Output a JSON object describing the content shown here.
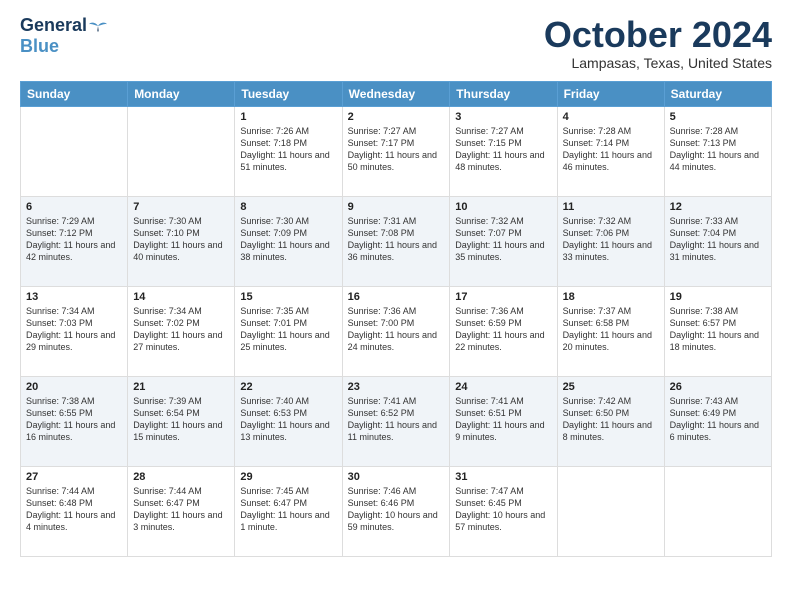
{
  "header": {
    "logo_general": "General",
    "logo_blue": "Blue",
    "month_title": "October 2024",
    "location": "Lampasas, Texas, United States"
  },
  "days_of_week": [
    "Sunday",
    "Monday",
    "Tuesday",
    "Wednesday",
    "Thursday",
    "Friday",
    "Saturday"
  ],
  "weeks": [
    [
      {
        "day": "",
        "sunrise": "",
        "sunset": "",
        "daylight": ""
      },
      {
        "day": "",
        "sunrise": "",
        "sunset": "",
        "daylight": ""
      },
      {
        "day": "1",
        "sunrise": "Sunrise: 7:26 AM",
        "sunset": "Sunset: 7:18 PM",
        "daylight": "Daylight: 11 hours and 51 minutes."
      },
      {
        "day": "2",
        "sunrise": "Sunrise: 7:27 AM",
        "sunset": "Sunset: 7:17 PM",
        "daylight": "Daylight: 11 hours and 50 minutes."
      },
      {
        "day": "3",
        "sunrise": "Sunrise: 7:27 AM",
        "sunset": "Sunset: 7:15 PM",
        "daylight": "Daylight: 11 hours and 48 minutes."
      },
      {
        "day": "4",
        "sunrise": "Sunrise: 7:28 AM",
        "sunset": "Sunset: 7:14 PM",
        "daylight": "Daylight: 11 hours and 46 minutes."
      },
      {
        "day": "5",
        "sunrise": "Sunrise: 7:28 AM",
        "sunset": "Sunset: 7:13 PM",
        "daylight": "Daylight: 11 hours and 44 minutes."
      }
    ],
    [
      {
        "day": "6",
        "sunrise": "Sunrise: 7:29 AM",
        "sunset": "Sunset: 7:12 PM",
        "daylight": "Daylight: 11 hours and 42 minutes."
      },
      {
        "day": "7",
        "sunrise": "Sunrise: 7:30 AM",
        "sunset": "Sunset: 7:10 PM",
        "daylight": "Daylight: 11 hours and 40 minutes."
      },
      {
        "day": "8",
        "sunrise": "Sunrise: 7:30 AM",
        "sunset": "Sunset: 7:09 PM",
        "daylight": "Daylight: 11 hours and 38 minutes."
      },
      {
        "day": "9",
        "sunrise": "Sunrise: 7:31 AM",
        "sunset": "Sunset: 7:08 PM",
        "daylight": "Daylight: 11 hours and 36 minutes."
      },
      {
        "day": "10",
        "sunrise": "Sunrise: 7:32 AM",
        "sunset": "Sunset: 7:07 PM",
        "daylight": "Daylight: 11 hours and 35 minutes."
      },
      {
        "day": "11",
        "sunrise": "Sunrise: 7:32 AM",
        "sunset": "Sunset: 7:06 PM",
        "daylight": "Daylight: 11 hours and 33 minutes."
      },
      {
        "day": "12",
        "sunrise": "Sunrise: 7:33 AM",
        "sunset": "Sunset: 7:04 PM",
        "daylight": "Daylight: 11 hours and 31 minutes."
      }
    ],
    [
      {
        "day": "13",
        "sunrise": "Sunrise: 7:34 AM",
        "sunset": "Sunset: 7:03 PM",
        "daylight": "Daylight: 11 hours and 29 minutes."
      },
      {
        "day": "14",
        "sunrise": "Sunrise: 7:34 AM",
        "sunset": "Sunset: 7:02 PM",
        "daylight": "Daylight: 11 hours and 27 minutes."
      },
      {
        "day": "15",
        "sunrise": "Sunrise: 7:35 AM",
        "sunset": "Sunset: 7:01 PM",
        "daylight": "Daylight: 11 hours and 25 minutes."
      },
      {
        "day": "16",
        "sunrise": "Sunrise: 7:36 AM",
        "sunset": "Sunset: 7:00 PM",
        "daylight": "Daylight: 11 hours and 24 minutes."
      },
      {
        "day": "17",
        "sunrise": "Sunrise: 7:36 AM",
        "sunset": "Sunset: 6:59 PM",
        "daylight": "Daylight: 11 hours and 22 minutes."
      },
      {
        "day": "18",
        "sunrise": "Sunrise: 7:37 AM",
        "sunset": "Sunset: 6:58 PM",
        "daylight": "Daylight: 11 hours and 20 minutes."
      },
      {
        "day": "19",
        "sunrise": "Sunrise: 7:38 AM",
        "sunset": "Sunset: 6:57 PM",
        "daylight": "Daylight: 11 hours and 18 minutes."
      }
    ],
    [
      {
        "day": "20",
        "sunrise": "Sunrise: 7:38 AM",
        "sunset": "Sunset: 6:55 PM",
        "daylight": "Daylight: 11 hours and 16 minutes."
      },
      {
        "day": "21",
        "sunrise": "Sunrise: 7:39 AM",
        "sunset": "Sunset: 6:54 PM",
        "daylight": "Daylight: 11 hours and 15 minutes."
      },
      {
        "day": "22",
        "sunrise": "Sunrise: 7:40 AM",
        "sunset": "Sunset: 6:53 PM",
        "daylight": "Daylight: 11 hours and 13 minutes."
      },
      {
        "day": "23",
        "sunrise": "Sunrise: 7:41 AM",
        "sunset": "Sunset: 6:52 PM",
        "daylight": "Daylight: 11 hours and 11 minutes."
      },
      {
        "day": "24",
        "sunrise": "Sunrise: 7:41 AM",
        "sunset": "Sunset: 6:51 PM",
        "daylight": "Daylight: 11 hours and 9 minutes."
      },
      {
        "day": "25",
        "sunrise": "Sunrise: 7:42 AM",
        "sunset": "Sunset: 6:50 PM",
        "daylight": "Daylight: 11 hours and 8 minutes."
      },
      {
        "day": "26",
        "sunrise": "Sunrise: 7:43 AM",
        "sunset": "Sunset: 6:49 PM",
        "daylight": "Daylight: 11 hours and 6 minutes."
      }
    ],
    [
      {
        "day": "27",
        "sunrise": "Sunrise: 7:44 AM",
        "sunset": "Sunset: 6:48 PM",
        "daylight": "Daylight: 11 hours and 4 minutes."
      },
      {
        "day": "28",
        "sunrise": "Sunrise: 7:44 AM",
        "sunset": "Sunset: 6:47 PM",
        "daylight": "Daylight: 11 hours and 3 minutes."
      },
      {
        "day": "29",
        "sunrise": "Sunrise: 7:45 AM",
        "sunset": "Sunset: 6:47 PM",
        "daylight": "Daylight: 11 hours and 1 minute."
      },
      {
        "day": "30",
        "sunrise": "Sunrise: 7:46 AM",
        "sunset": "Sunset: 6:46 PM",
        "daylight": "Daylight: 10 hours and 59 minutes."
      },
      {
        "day": "31",
        "sunrise": "Sunrise: 7:47 AM",
        "sunset": "Sunset: 6:45 PM",
        "daylight": "Daylight: 10 hours and 57 minutes."
      },
      {
        "day": "",
        "sunrise": "",
        "sunset": "",
        "daylight": ""
      },
      {
        "day": "",
        "sunrise": "",
        "sunset": "",
        "daylight": ""
      }
    ]
  ]
}
